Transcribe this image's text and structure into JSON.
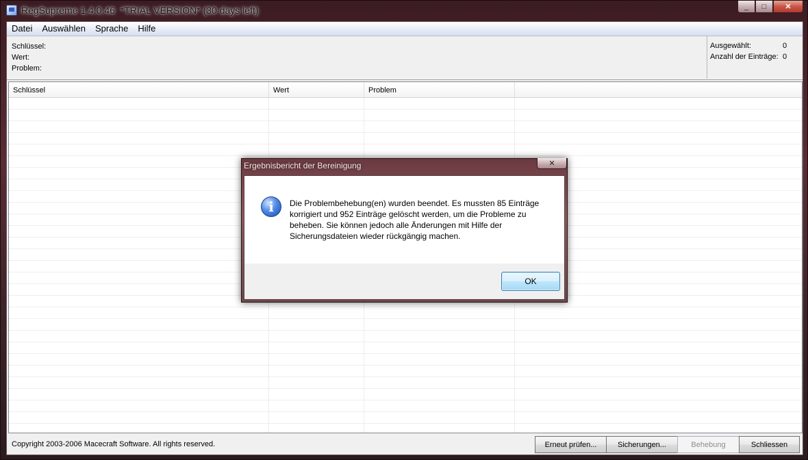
{
  "window": {
    "title": "RegSupreme 1.4.0.46  *TRIAL VERSION* (30 days left)",
    "minimize_glyph": "_",
    "maximize_glyph": "□",
    "close_glyph": "✕"
  },
  "menu": {
    "items": [
      "Datei",
      "Auswählen",
      "Sprache",
      "Hilfe"
    ]
  },
  "info": {
    "left": {
      "key_label": "Schlüssel:",
      "value_label": "Wert:",
      "problem_label": "Problem:"
    },
    "right": {
      "selected_label": "Ausgewählt:",
      "selected_value": "0",
      "count_label": "Anzahl der Einträge:",
      "count_value": "0"
    }
  },
  "list": {
    "columns": [
      "Schlüssel",
      "Wert",
      "Problem"
    ]
  },
  "status": {
    "copyright": "Copyright 2003-2006 Macecraft Software. All rights reserved.",
    "buttons": {
      "rescan": "Erneut prüfen...",
      "backups": "Sicherungen...",
      "fix": "Behebung",
      "close": "Schliessen"
    }
  },
  "dialog": {
    "title": "Ergebnisbericht der Bereinigung",
    "close_glyph": "✕",
    "icon_glyph": "i",
    "message": "Die Problembehebung(en) wurden beendet. Es mussten 85 Einträge korrigiert und 952 Einträge gelöscht werden, um die Probleme zu beheben. Sie können jedoch alle Änderungen mit Hilfe der Sicherungsdateien wieder rückgängig machen.",
    "ok_label": "OK"
  }
}
